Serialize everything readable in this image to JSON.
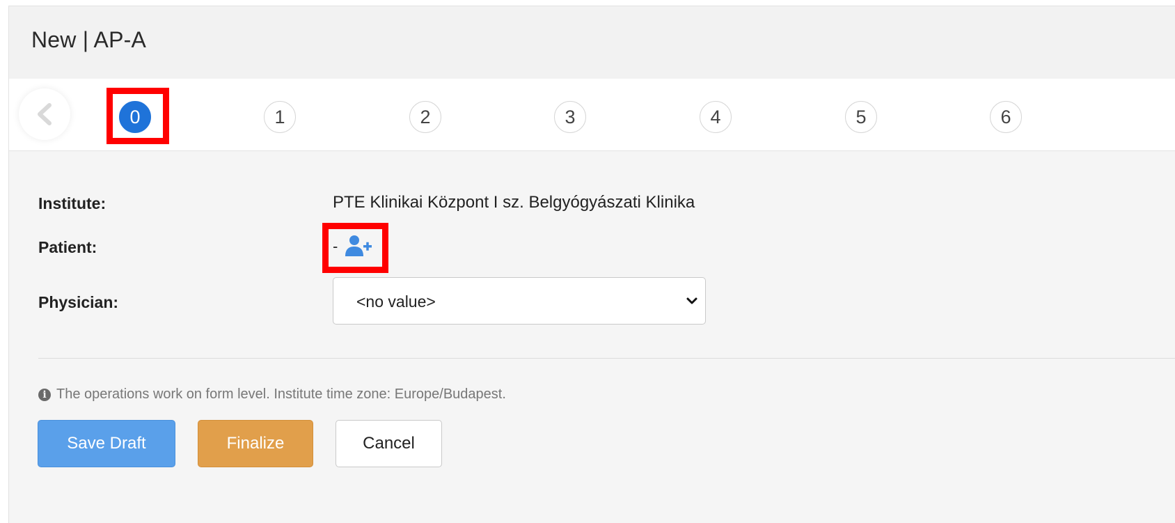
{
  "header": {
    "title": "New | AP-A"
  },
  "stepper": {
    "steps": [
      "0",
      "1",
      "2",
      "3",
      "4",
      "5",
      "6"
    ],
    "active_step": "0"
  },
  "form": {
    "institute_label": "Institute:",
    "institute_value": "PTE Klinikai Központ I sz. Belgyógyászati Klinika",
    "patient_label": "Patient:",
    "patient_value": "-",
    "physician_label": "Physician:",
    "physician_selected": "<no value>"
  },
  "footer": {
    "note": "The operations work on form level. Institute time zone: Europe/Budapest.",
    "save_draft_label": "Save Draft",
    "finalize_label": "Finalize",
    "cancel_label": "Cancel"
  },
  "colors": {
    "active_step": "#1f73d9",
    "save_draft": "#5aa0ea",
    "finalize": "#e19f4b",
    "highlight": "#ff0000",
    "patient_icon": "#3f8ae0"
  },
  "icons": {
    "prev": "chevron-left-icon",
    "patient_add": "user-plus-icon",
    "physician_select": "chevron-down-icon",
    "note": "info-circle-icon"
  }
}
